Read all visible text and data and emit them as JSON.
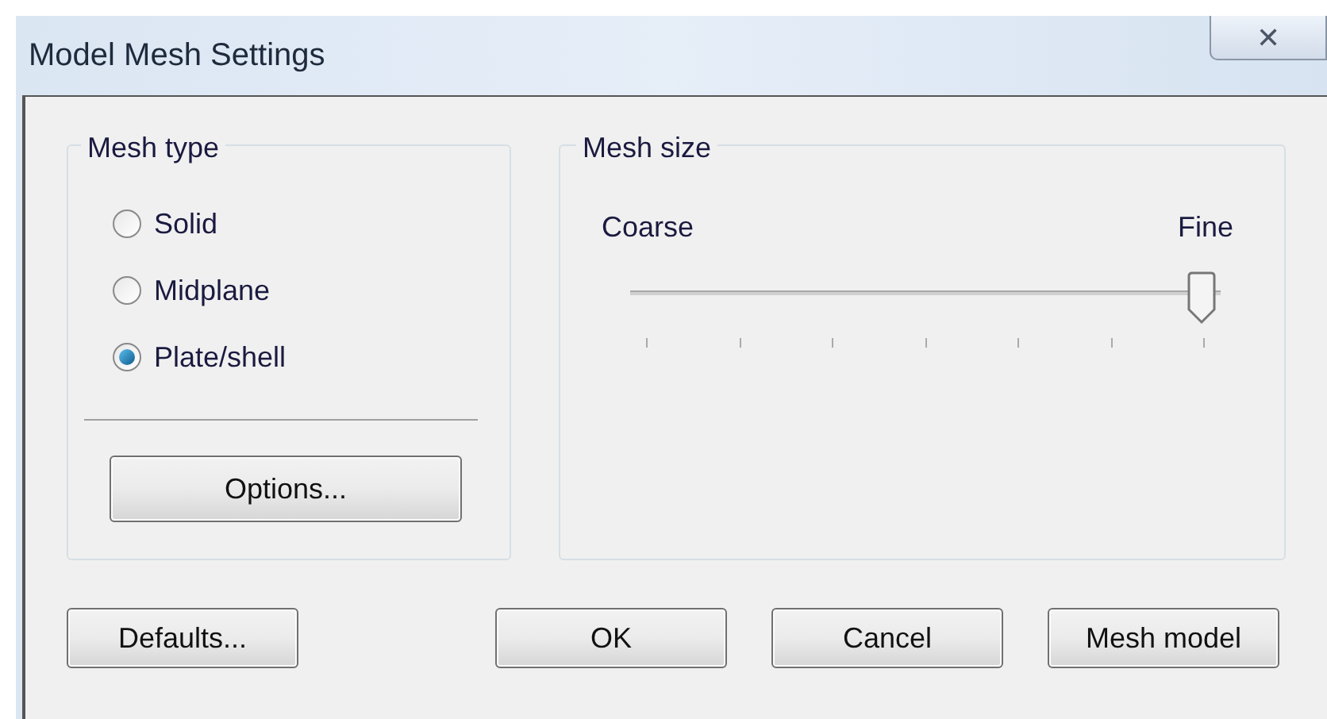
{
  "window": {
    "title": "Model Mesh Settings",
    "close": "✕"
  },
  "mesh_type": {
    "title": "Mesh type",
    "options": [
      {
        "label": "Solid",
        "selected": false
      },
      {
        "label": "Midplane",
        "selected": false
      },
      {
        "label": "Plate/shell",
        "selected": true
      }
    ],
    "button": "Options..."
  },
  "mesh_size": {
    "title": "Mesh size",
    "min_label": "Coarse",
    "max_label": "Fine",
    "level": 1.0
  },
  "buttons": {
    "left": "Defaults...",
    "right": [
      "OK",
      "Cancel",
      "Mesh model"
    ]
  }
}
